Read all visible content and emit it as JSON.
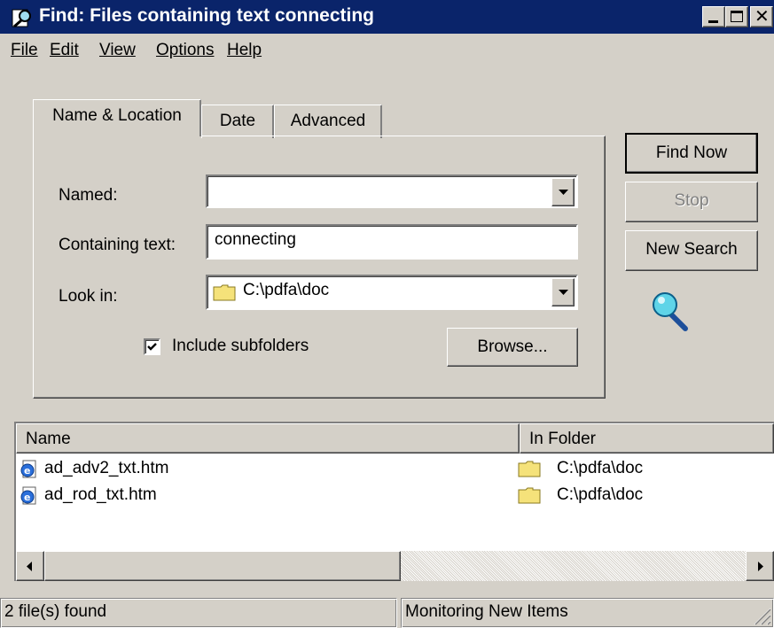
{
  "window": {
    "title": "Find: Files containing text connecting"
  },
  "menu": [
    "File",
    "Edit",
    "View",
    "Options",
    "Help"
  ],
  "tabs": {
    "name_location": "Name & Location",
    "date": "Date",
    "advanced": "Advanced"
  },
  "form": {
    "named_label": "Named:",
    "named_value": "",
    "containing_label": "Containing text:",
    "containing_value": "connecting",
    "lookin_label": "Look in:",
    "lookin_value": "C:\\pdfa\\doc",
    "include_subfolders_label": "Include subfolders",
    "include_subfolders_checked": true,
    "browse_label": "Browse..."
  },
  "buttons": {
    "find_now": "Find Now",
    "stop": "Stop",
    "new_search": "New Search"
  },
  "results": {
    "columns": [
      "Name",
      "In Folder"
    ],
    "rows": [
      {
        "name": "ad_adv2_txt.htm",
        "folder": "C:\\pdfa\\doc"
      },
      {
        "name": "ad_rod_txt.htm",
        "folder": "C:\\pdfa\\doc"
      }
    ]
  },
  "status": {
    "count": "2 file(s) found",
    "monitor": "Monitoring New Items"
  },
  "colors": {
    "titlebar": "#0a246a",
    "face": "#d4d0c8",
    "folder": "#f5e27a"
  }
}
